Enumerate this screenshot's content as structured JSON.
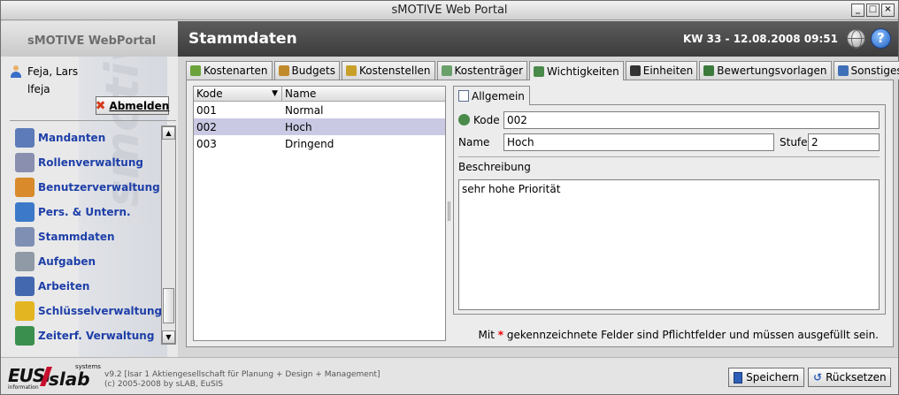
{
  "window": {
    "title": "sMOTIVE Web Portal",
    "controls": [
      "_",
      "□",
      "×"
    ]
  },
  "header": {
    "brand": "sMOTIVE WebPortal",
    "page_title": "Stammdaten",
    "week_date": "KW 33 - 12.08.2008 09:51",
    "help": "?"
  },
  "sidebar": {
    "watermark": "smotive WEBPORTAL",
    "user_name": "Feja, Lars",
    "user_login": "lfeja",
    "logout_label": "Abmelden",
    "items": [
      {
        "label": "Mandanten",
        "icon": "clients-icon",
        "color": "#5d7bb8"
      },
      {
        "label": "Rollenverwaltung",
        "icon": "roles-icon",
        "color": "#8a8fb0"
      },
      {
        "label": "Benutzerverwaltung",
        "icon": "users-icon",
        "color": "#d98a2b"
      },
      {
        "label": "Pers. & Untern.",
        "icon": "persons-companies-icon",
        "color": "#3d79c9"
      },
      {
        "label": "Stammdaten",
        "icon": "master-data-icon",
        "color": "#7f8fb3"
      },
      {
        "label": "Aufgaben",
        "icon": "tasks-icon",
        "color": "#8f9aa6"
      },
      {
        "label": "Arbeiten",
        "icon": "work-icon",
        "color": "#4468b0"
      },
      {
        "label": "Schlüsselverwaltung",
        "icon": "keys-icon",
        "color": "#e3b520"
      },
      {
        "label": "Zeiterf. Verwaltung",
        "icon": "time-tracking-icon",
        "color": "#3a8f4f"
      }
    ]
  },
  "tabs": [
    {
      "label": "Kostenarten",
      "icon": "cost-types-icon",
      "color": "#6ba33a",
      "active": false
    },
    {
      "label": "Budgets",
      "icon": "budgets-icon",
      "color": "#c08a2a",
      "active": false
    },
    {
      "label": "Kostenstellen",
      "icon": "cost-centers-icon",
      "color": "#c9a02a",
      "active": false
    },
    {
      "label": "Kostenträger",
      "icon": "cost-objects-icon",
      "color": "#6aa06a",
      "active": false
    },
    {
      "label": "Wichtigkeiten",
      "icon": "priorities-icon",
      "color": "#4a8a4a",
      "active": true
    },
    {
      "label": "Einheiten",
      "icon": "units-icon",
      "color": "#333333",
      "active": false
    },
    {
      "label": "Bewertungsvorlagen",
      "icon": "rating-templates-icon",
      "color": "#3b7a3b",
      "active": false
    },
    {
      "label": "Sonstiges",
      "icon": "misc-icon",
      "color": "#3f6fb8",
      "active": false
    }
  ],
  "list": {
    "columns": [
      "Kode",
      "Name"
    ],
    "rows": [
      {
        "code": "001",
        "name": "Normal",
        "selected": false
      },
      {
        "code": "002",
        "name": "Hoch",
        "selected": true
      },
      {
        "code": "003",
        "name": "Dringend",
        "selected": false
      }
    ]
  },
  "detail": {
    "tab_label": "Allgemein",
    "code_label": "Kode",
    "code_value": "002",
    "name_label": "Name",
    "name_value": "Hoch",
    "level_label": "Stufe",
    "level_value": "2",
    "description_label": "Beschreibung",
    "description_value": "sehr hohe Priorität",
    "hint_prefix": "Mit",
    "hint_star": "*",
    "hint_suffix": "gekennzeichnete Felder sind Pflichtfelder und müssen ausgefüllt sein."
  },
  "footer": {
    "logo": {
      "eusi": "EUSI",
      "slab": "slab",
      "systems": "systems",
      "info": "information"
    },
    "version_line1": "v9.2 [Isar 1 Aktiengesellschaft für Planung + Design + Management]",
    "version_line2": "(c) 2005-2008 by sLAB, EuSIS",
    "save_label": "Speichern",
    "reset_label": "Rücksetzen"
  },
  "colors": {
    "header_bg": "#4a4a4a",
    "nav_text": "#1e3fa8",
    "selection": "#c9c9e3",
    "required_star": "#ee0000"
  }
}
